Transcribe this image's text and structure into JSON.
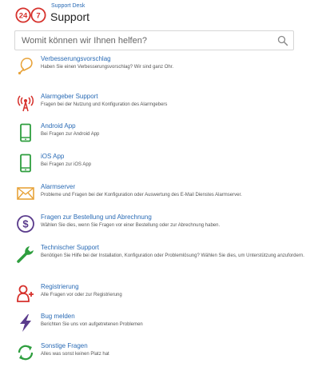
{
  "header": {
    "logo": {
      "left": "24",
      "right": "7",
      "color": "#d6312c"
    },
    "small_label": "Support Desk",
    "title": "Support"
  },
  "search": {
    "placeholder": "Womit können wir Ihnen helfen?",
    "icon": "search-icon"
  },
  "items": [
    {
      "icon": "lightbulb-icon",
      "color": "#e8a33a",
      "title": "Verbesserungsvorschlag",
      "desc": "Haben Sie einen Verbesserungsvorschlag? Wir sind ganz Ohr."
    },
    {
      "icon": "broadcast-icon",
      "color": "#d6312c",
      "title": "Alarmgeber Support",
      "desc": "Fragen bei der Nutzung und Konfiguration des Alarmgebers"
    },
    {
      "icon": "android-phone-icon",
      "color": "#2e9e3e",
      "title": "Android App",
      "desc": "Bei Fragen zur Android App"
    },
    {
      "icon": "ios-phone-icon",
      "color": "#2e9e3e",
      "title": "iOS App",
      "desc": "Bei Fragen zur iOS App"
    },
    {
      "icon": "envelope-icon",
      "color": "#e8a33a",
      "title": "Alarmserver",
      "desc": "Probleme und Fragen bei der Konfiguration oder Auswertung des E-Mail Dienstes Alarmserver."
    },
    {
      "icon": "dollar-icon",
      "color": "#5a3b8c",
      "title": "Fragen zur Bestellung und Abrechnung",
      "desc": "Wählen Sie dies, wenn Sie Fragen vor einer Bestellung oder zur Abrechnung haben."
    },
    {
      "icon": "wrench-icon",
      "color": "#2e9e3e",
      "title": "Technischer Support",
      "desc": "Benötigen Sie Hilfe bei der Installation, Konfiguration oder Problemlösung? Wählen Sie dies, um Unterstützung anzufordern."
    },
    {
      "icon": "add-user-icon",
      "color": "#d6312c",
      "title": "Registrierung",
      "desc": "Alle Fragen vor oder zur Registrierung"
    },
    {
      "icon": "lightning-icon",
      "color": "#5a3b8c",
      "title": "Bug melden",
      "desc": "Berichten Sie uns von aufgetretenen Problemen"
    },
    {
      "icon": "refresh-icon",
      "color": "#2e9e3e",
      "title": "Sonstige Fragen",
      "desc": "Alles was sonst keinen Platz hat"
    }
  ]
}
